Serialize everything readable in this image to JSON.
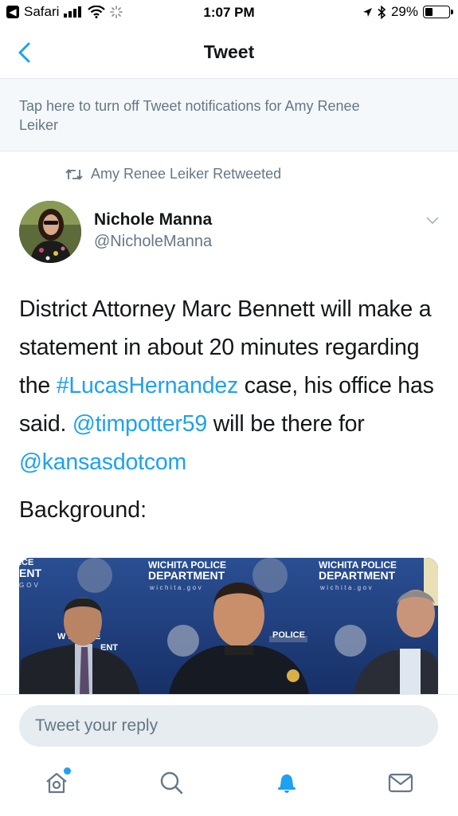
{
  "status_bar": {
    "back_app": "Safari",
    "time": "1:07 PM",
    "battery": "29%"
  },
  "nav": {
    "title": "Tweet"
  },
  "notification_banner": "Tap here to turn off Tweet notifications for Amy Renee Leiker",
  "retweet_context": "Amy Renee Leiker Retweeted",
  "tweet": {
    "author_name": "Nichole Manna",
    "author_handle": "@NicholeManna",
    "text_parts": {
      "p1": "District Attorney Marc Bennett will make a statement in about 20 minutes regarding the ",
      "hashtag": "#LucasHernandez",
      "p2": " case, his office has said. ",
      "mention1": "@timpotter59",
      "p3": " will be there for ",
      "mention2": "@kansasdotcom"
    },
    "text_line2": "Background:",
    "media_signage": {
      "left_partial": "ICE",
      "left_partial2": "ENT",
      "left_partial3": "GOV",
      "sign_title": "WICHITA POLICE",
      "sign_dept": "DEPARTMENT",
      "sign_url": "wichita.gov",
      "banner_partial1": "W    POLICE",
      "banner_partial2": "ENT",
      "podium": "POLICE"
    }
  },
  "reply": {
    "placeholder": "Tweet your reply"
  },
  "tabs": [
    "home",
    "search",
    "notifications",
    "messages"
  ],
  "colors": {
    "accent": "#1da1f2",
    "muted": "#657786",
    "text": "#14171a"
  }
}
